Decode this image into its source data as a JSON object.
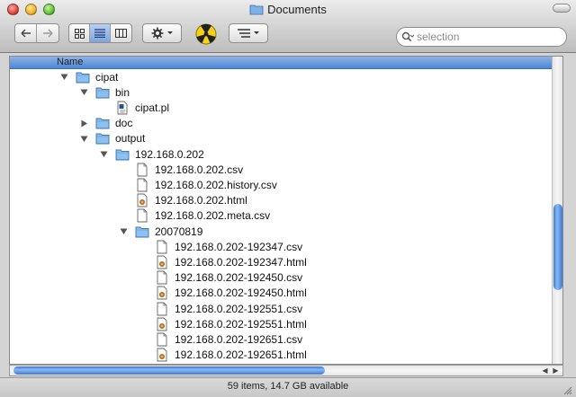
{
  "window": {
    "title": "Documents",
    "status": "59 items, 14.7 GB available",
    "accent": "#4c86d8"
  },
  "toolbar": {
    "back_forward": [
      "back",
      "forward"
    ],
    "view_modes": [
      "icon-view",
      "list-view",
      "column-view"
    ],
    "active_view": "list-view",
    "search_placeholder": "selection"
  },
  "list": {
    "column_header": "Name",
    "rows": [
      {
        "label": "cipat",
        "type": "folder",
        "depth": 0,
        "disclosure": "open"
      },
      {
        "label": "bin",
        "type": "folder",
        "depth": 1,
        "disclosure": "open"
      },
      {
        "label": "cipat.pl",
        "type": "script",
        "depth": 2,
        "disclosure": "none"
      },
      {
        "label": "doc",
        "type": "folder",
        "depth": 1,
        "disclosure": "closed"
      },
      {
        "label": "output",
        "type": "folder",
        "depth": 1,
        "disclosure": "open"
      },
      {
        "label": "192.168.0.202",
        "type": "folder",
        "depth": 2,
        "disclosure": "open"
      },
      {
        "label": "192.168.0.202.csv",
        "type": "file",
        "depth": 3,
        "disclosure": "none"
      },
      {
        "label": "192.168.0.202.history.csv",
        "type": "file",
        "depth": 3,
        "disclosure": "none"
      },
      {
        "label": "192.168.0.202.html",
        "type": "html",
        "depth": 3,
        "disclosure": "none"
      },
      {
        "label": "192.168.0.202.meta.csv",
        "type": "file",
        "depth": 3,
        "disclosure": "none"
      },
      {
        "label": "20070819",
        "type": "folder",
        "depth": 3,
        "disclosure": "open"
      },
      {
        "label": "192.168.0.202-192347.csv",
        "type": "file",
        "depth": 4,
        "disclosure": "none"
      },
      {
        "label": "192.168.0.202-192347.html",
        "type": "html",
        "depth": 4,
        "disclosure": "none"
      },
      {
        "label": "192.168.0.202-192450.csv",
        "type": "file",
        "depth": 4,
        "disclosure": "none"
      },
      {
        "label": "192.168.0.202-192450.html",
        "type": "html",
        "depth": 4,
        "disclosure": "none"
      },
      {
        "label": "192.168.0.202-192551.csv",
        "type": "file",
        "depth": 4,
        "disclosure": "none"
      },
      {
        "label": "192.168.0.202-192551.html",
        "type": "html",
        "depth": 4,
        "disclosure": "none"
      },
      {
        "label": "192.168.0.202-192651.csv",
        "type": "file",
        "depth": 4,
        "disclosure": "none"
      },
      {
        "label": "192.168.0.202-192651.html",
        "type": "html",
        "depth": 4,
        "disclosure": "none"
      }
    ]
  }
}
